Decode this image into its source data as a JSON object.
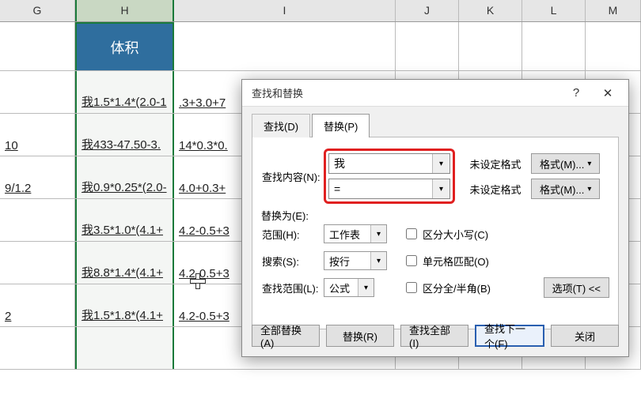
{
  "columns": [
    "G",
    "H",
    "I",
    "J",
    "K",
    "L",
    "M"
  ],
  "h_column_header_label": "体积",
  "rows": [
    {
      "g": "",
      "h": "我1.5*1.4*(2.0-1",
      "i": ".3+3.0+7"
    },
    {
      "g": "10",
      "h": "我433-47.50-3.",
      "i": "14*0.3*0."
    },
    {
      "g": "9/1.2",
      "h": "我0.9*0.25*(2.0-",
      "i": "4.0+0.3+"
    },
    {
      "g": "",
      "h": "我3.5*1.0*(4.1+",
      "i": "4.2-0.5+3"
    },
    {
      "g": "",
      "h": "我8.8*1.4*(4.1+",
      "i": "4.2-0.5+3"
    },
    {
      "g": "2",
      "h": "我1.5*1.8*(4.1+",
      "i": "4.2-0.5+3"
    }
  ],
  "dialog": {
    "title": "查找和替换",
    "help": "?",
    "close": "✕",
    "tab_find": "查找(D)",
    "tab_replace": "替换(P)",
    "find_label": "查找内容(N):",
    "replace_label": "替换为(E):",
    "find_value": "我",
    "replace_value": "=",
    "no_format": "未设定格式",
    "format_btn": "格式(M)...",
    "scope_label": "范围(H):",
    "scope_value": "工作表",
    "search_label": "搜索(S):",
    "search_value": "按行",
    "lookin_label": "查找范围(L):",
    "lookin_value": "公式",
    "chk_case": "区分大小写(C)",
    "chk_whole": "单元格匹配(O)",
    "chk_width": "区分全/半角(B)",
    "options_btn": "选项(T) <<",
    "btn_replace_all": "全部替换(A)",
    "btn_replace": "替换(R)",
    "btn_find_all": "查找全部(I)",
    "btn_find_next": "查找下一个(F)",
    "btn_close": "关闭"
  }
}
